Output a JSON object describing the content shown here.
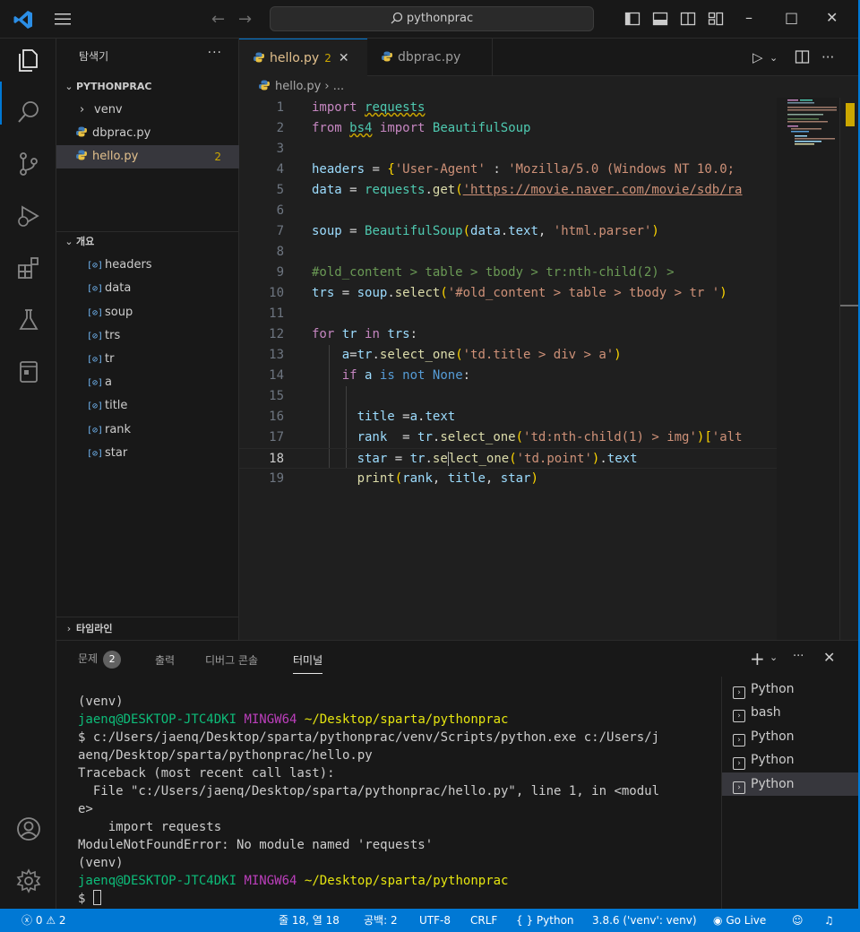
{
  "titlebar": {
    "search_text": "pythonprac",
    "minimize": "–",
    "maximize": "□",
    "close": "✕"
  },
  "sidebar": {
    "header": "탐색기",
    "more": "···",
    "project": "PYTHONPRAC",
    "files": [
      {
        "label": "venv",
        "type": "folder"
      },
      {
        "label": "dbprac.py",
        "type": "python"
      },
      {
        "label": "hello.py",
        "type": "python",
        "badge": "2",
        "selected": true
      }
    ],
    "outline_title": "개요",
    "outline_items": [
      "headers",
      "data",
      "soup",
      "trs",
      "tr",
      "a",
      "title",
      "rank",
      "star"
    ],
    "timeline_title": "타임라인"
  },
  "tabs": [
    {
      "label": "hello.py",
      "badge": "2",
      "active": true
    },
    {
      "label": "dbprac.py",
      "active": false
    }
  ],
  "breadcrumb": {
    "file": "hello.py",
    "rest": "..."
  },
  "code": {
    "current_line": 18,
    "lines": [
      "1",
      "2",
      "3",
      "4",
      "5",
      "6",
      "7",
      "8",
      "9",
      "10",
      "11",
      "12",
      "13",
      "14",
      "15",
      "16",
      "17",
      "18",
      "19"
    ]
  },
  "panel": {
    "tabs": [
      {
        "label": "문제",
        "badge": "2"
      },
      {
        "label": "출력"
      },
      {
        "label": "디버그 콘솔"
      },
      {
        "label": "터미널",
        "active": true
      }
    ],
    "terminal_lines": {
      "l1": "(venv)",
      "l2_user": "jaenq@DESKTOP-JTC4DKI",
      "l2_env": "MINGW64",
      "l2_path": "~/Desktop/sparta/pythonprac",
      "l3": "$ c:/Users/jaenq/Desktop/sparta/pythonprac/venv/Scripts/python.exe c:/Users/j",
      "l4": "aenq/Desktop/sparta/pythonprac/hello.py",
      "l5": "Traceback (most recent call last):",
      "l6": "  File \"c:/Users/jaenq/Desktop/sparta/pythonprac/hello.py\", line 1, in <modul",
      "l7": "e>",
      "l8": "    import requests",
      "l9": "ModuleNotFoundError: No module named 'requests'",
      "l10": "(venv)",
      "l11_user": "jaenq@DESKTOP-JTC4DKI",
      "l11_env": "MINGW64",
      "l11_path": "~/Desktop/sparta/pythonprac",
      "prompt": "$"
    },
    "terminals": [
      "Python",
      "bash",
      "Python",
      "Python",
      "Python"
    ]
  },
  "statusbar": {
    "errors": "0",
    "warnings": "2",
    "position": "줄 18, 열 18",
    "spaces": "공백: 2",
    "encoding": "UTF-8",
    "eol": "CRLF",
    "language": "Python",
    "interpreter": "3.8.6 ('venv': venv)",
    "golive": "Go Live"
  },
  "colors": {
    "accent": "#0078d4",
    "warning": "#cca700"
  }
}
